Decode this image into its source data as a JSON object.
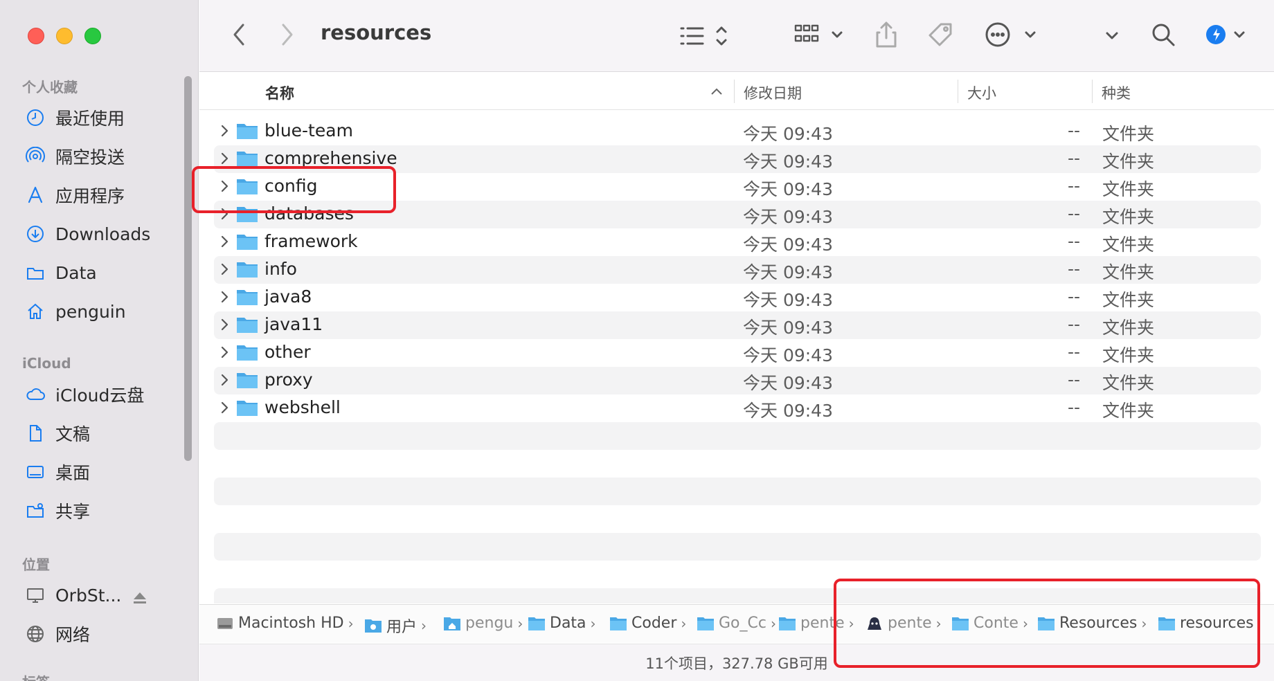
{
  "window": {
    "title": "resources"
  },
  "sidebar": {
    "favorites_header": "个人收藏",
    "favorites": [
      {
        "label": "最近使用",
        "icon": "clock-icon"
      },
      {
        "label": "隔空投送",
        "icon": "airdrop-icon"
      },
      {
        "label": "应用程序",
        "icon": "applications-icon"
      },
      {
        "label": "Downloads",
        "icon": "download-icon"
      },
      {
        "label": "Data",
        "icon": "folder-icon"
      },
      {
        "label": "penguin",
        "icon": "home-icon"
      }
    ],
    "icloud_header": "iCloud",
    "icloud": [
      {
        "label": "iCloud云盘",
        "icon": "cloud-icon"
      },
      {
        "label": "文稿",
        "icon": "document-icon"
      },
      {
        "label": "桌面",
        "icon": "desktop-icon"
      },
      {
        "label": "共享",
        "icon": "shared-folder-icon"
      }
    ],
    "locations_header": "位置",
    "locations": [
      {
        "label": "OrbSt...",
        "icon": "computer-icon"
      },
      {
        "label": "网络",
        "icon": "network-icon"
      }
    ],
    "tags_header_partial": "标签"
  },
  "columns": {
    "name": "名称",
    "date": "修改日期",
    "size": "大小",
    "kind": "种类"
  },
  "files": [
    {
      "name": "blue-team",
      "date": "今天 09:43",
      "size": "--",
      "kind": "文件夹"
    },
    {
      "name": "comprehensive",
      "date": "今天 09:43",
      "size": "--",
      "kind": "文件夹"
    },
    {
      "name": "config",
      "date": "今天 09:43",
      "size": "--",
      "kind": "文件夹"
    },
    {
      "name": "databases",
      "date": "今天 09:43",
      "size": "--",
      "kind": "文件夹"
    },
    {
      "name": "framework",
      "date": "今天 09:43",
      "size": "--",
      "kind": "文件夹"
    },
    {
      "name": "info",
      "date": "今天 09:43",
      "size": "--",
      "kind": "文件夹"
    },
    {
      "name": "java8",
      "date": "今天 09:43",
      "size": "--",
      "kind": "文件夹"
    },
    {
      "name": "java11",
      "date": "今天 09:43",
      "size": "--",
      "kind": "文件夹"
    },
    {
      "name": "other",
      "date": "今天 09:43",
      "size": "--",
      "kind": "文件夹"
    },
    {
      "name": "proxy",
      "date": "今天 09:43",
      "size": "--",
      "kind": "文件夹"
    },
    {
      "name": "webshell",
      "date": "今天 09:43",
      "size": "--",
      "kind": "文件夹"
    }
  ],
  "path": [
    {
      "label": "Macintosh HD",
      "icon": "disk-icon"
    },
    {
      "label": "用户",
      "icon": "users-folder-icon"
    },
    {
      "label": "pengu",
      "icon": "home-folder-icon"
    },
    {
      "label": "Data",
      "icon": "folder-icon"
    },
    {
      "label": "Coder",
      "icon": "folder-icon"
    },
    {
      "label": "Go_Cc",
      "icon": "folder-icon"
    },
    {
      "label": "pente",
      "icon": "folder-icon"
    },
    {
      "label": "pente",
      "icon": "app-icon"
    },
    {
      "label": "Conte",
      "icon": "folder-icon"
    },
    {
      "label": "Resources",
      "icon": "folder-icon"
    },
    {
      "label": "resources",
      "icon": "folder-icon"
    }
  ],
  "status": "11个项目，327.78 GB可用",
  "colors": {
    "accent": "#1a7df0",
    "folder": "#5bb8f0",
    "annotation": "#e8212a"
  }
}
